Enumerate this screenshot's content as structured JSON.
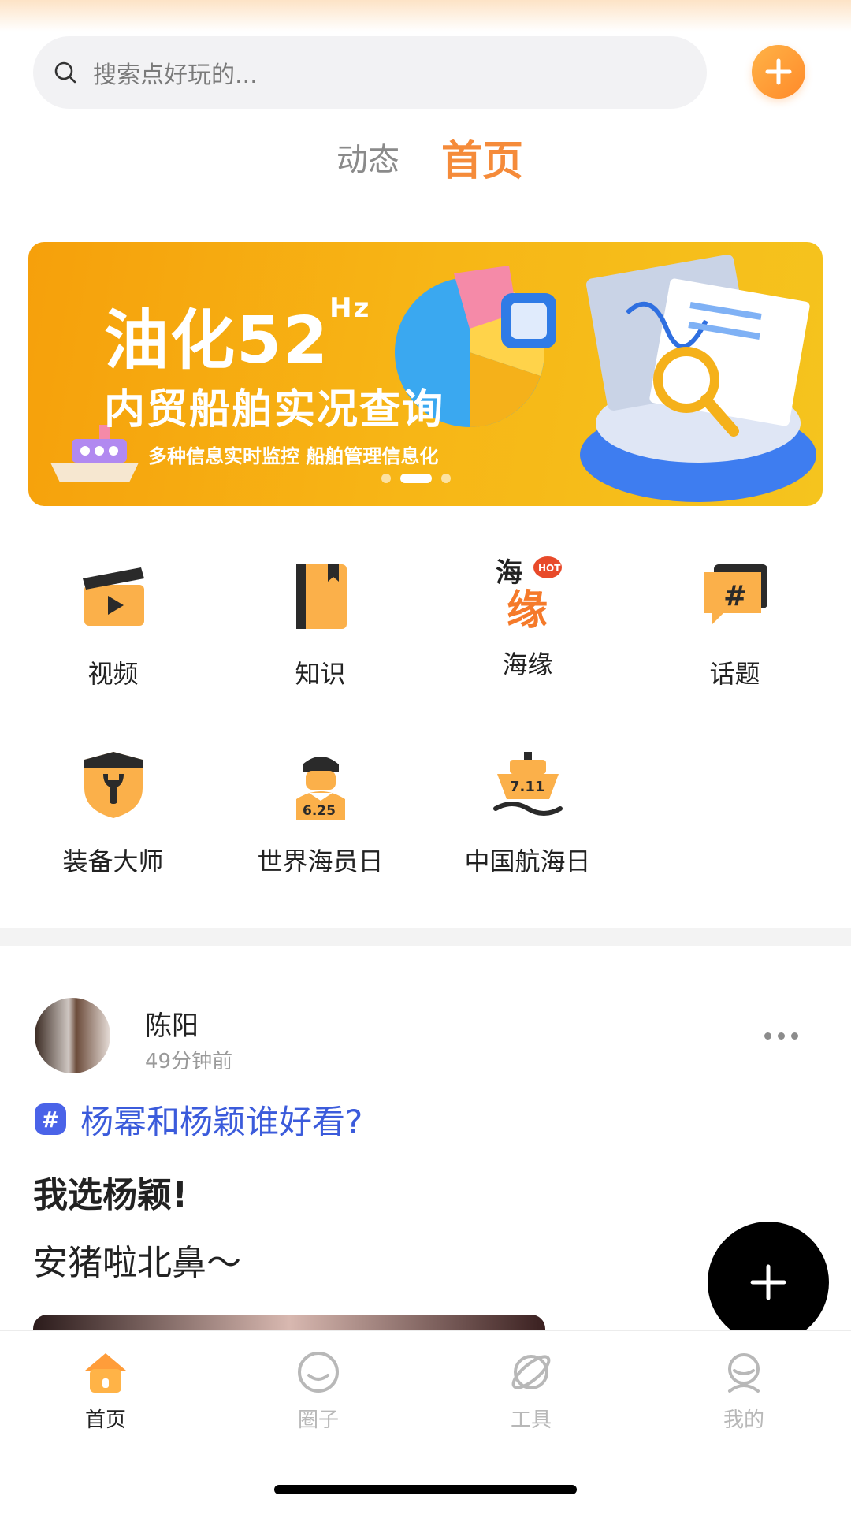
{
  "search": {
    "placeholder": "搜索点好玩的..."
  },
  "tabs": [
    {
      "label": "动态",
      "active": false
    },
    {
      "label": "首页",
      "active": true
    }
  ],
  "banner": {
    "title": "油化52",
    "title_sup": "Hz",
    "subtitle": "内贸船舶实况查询",
    "desc": "多种信息实时监控 船舶管理信息化",
    "pages": 3,
    "active_page": 2
  },
  "grid": [
    {
      "label": "视频",
      "icon": "video-icon"
    },
    {
      "label": "知识",
      "icon": "book-icon"
    },
    {
      "label": "海缘",
      "icon": "haiyuan-hot-icon"
    },
    {
      "label": "话题",
      "icon": "topic-icon"
    },
    {
      "label": "装备大师",
      "icon": "shield-wrench-icon"
    },
    {
      "label": "世界海员日",
      "icon": "sailor-day-icon"
    },
    {
      "label": "中国航海日",
      "icon": "ship-day-icon"
    }
  ],
  "grid_icon_text": {
    "hot": "HOT",
    "sailor_date": "6.25",
    "ship_date": "7.11",
    "haiyuan_top": "海",
    "haiyuan_bottom": "缘"
  },
  "post": {
    "author": "陈阳",
    "time": "49分钟前",
    "topic_badge": "#",
    "topic": "杨幂和杨颖谁好看?",
    "bold_text": "我选杨颖!",
    "text": "安猪啦北鼻～"
  },
  "bottom_nav": [
    {
      "label": "首页",
      "active": true,
      "icon": "home-icon"
    },
    {
      "label": "圈子",
      "active": false,
      "icon": "circle-chat-icon"
    },
    {
      "label": "工具",
      "active": false,
      "icon": "planet-tool-icon"
    },
    {
      "label": "我的",
      "active": false,
      "icon": "profile-icon"
    }
  ],
  "colors": {
    "accent": "#f58b3a",
    "topic": "#3b5bdb",
    "banner": "#f7b616"
  }
}
